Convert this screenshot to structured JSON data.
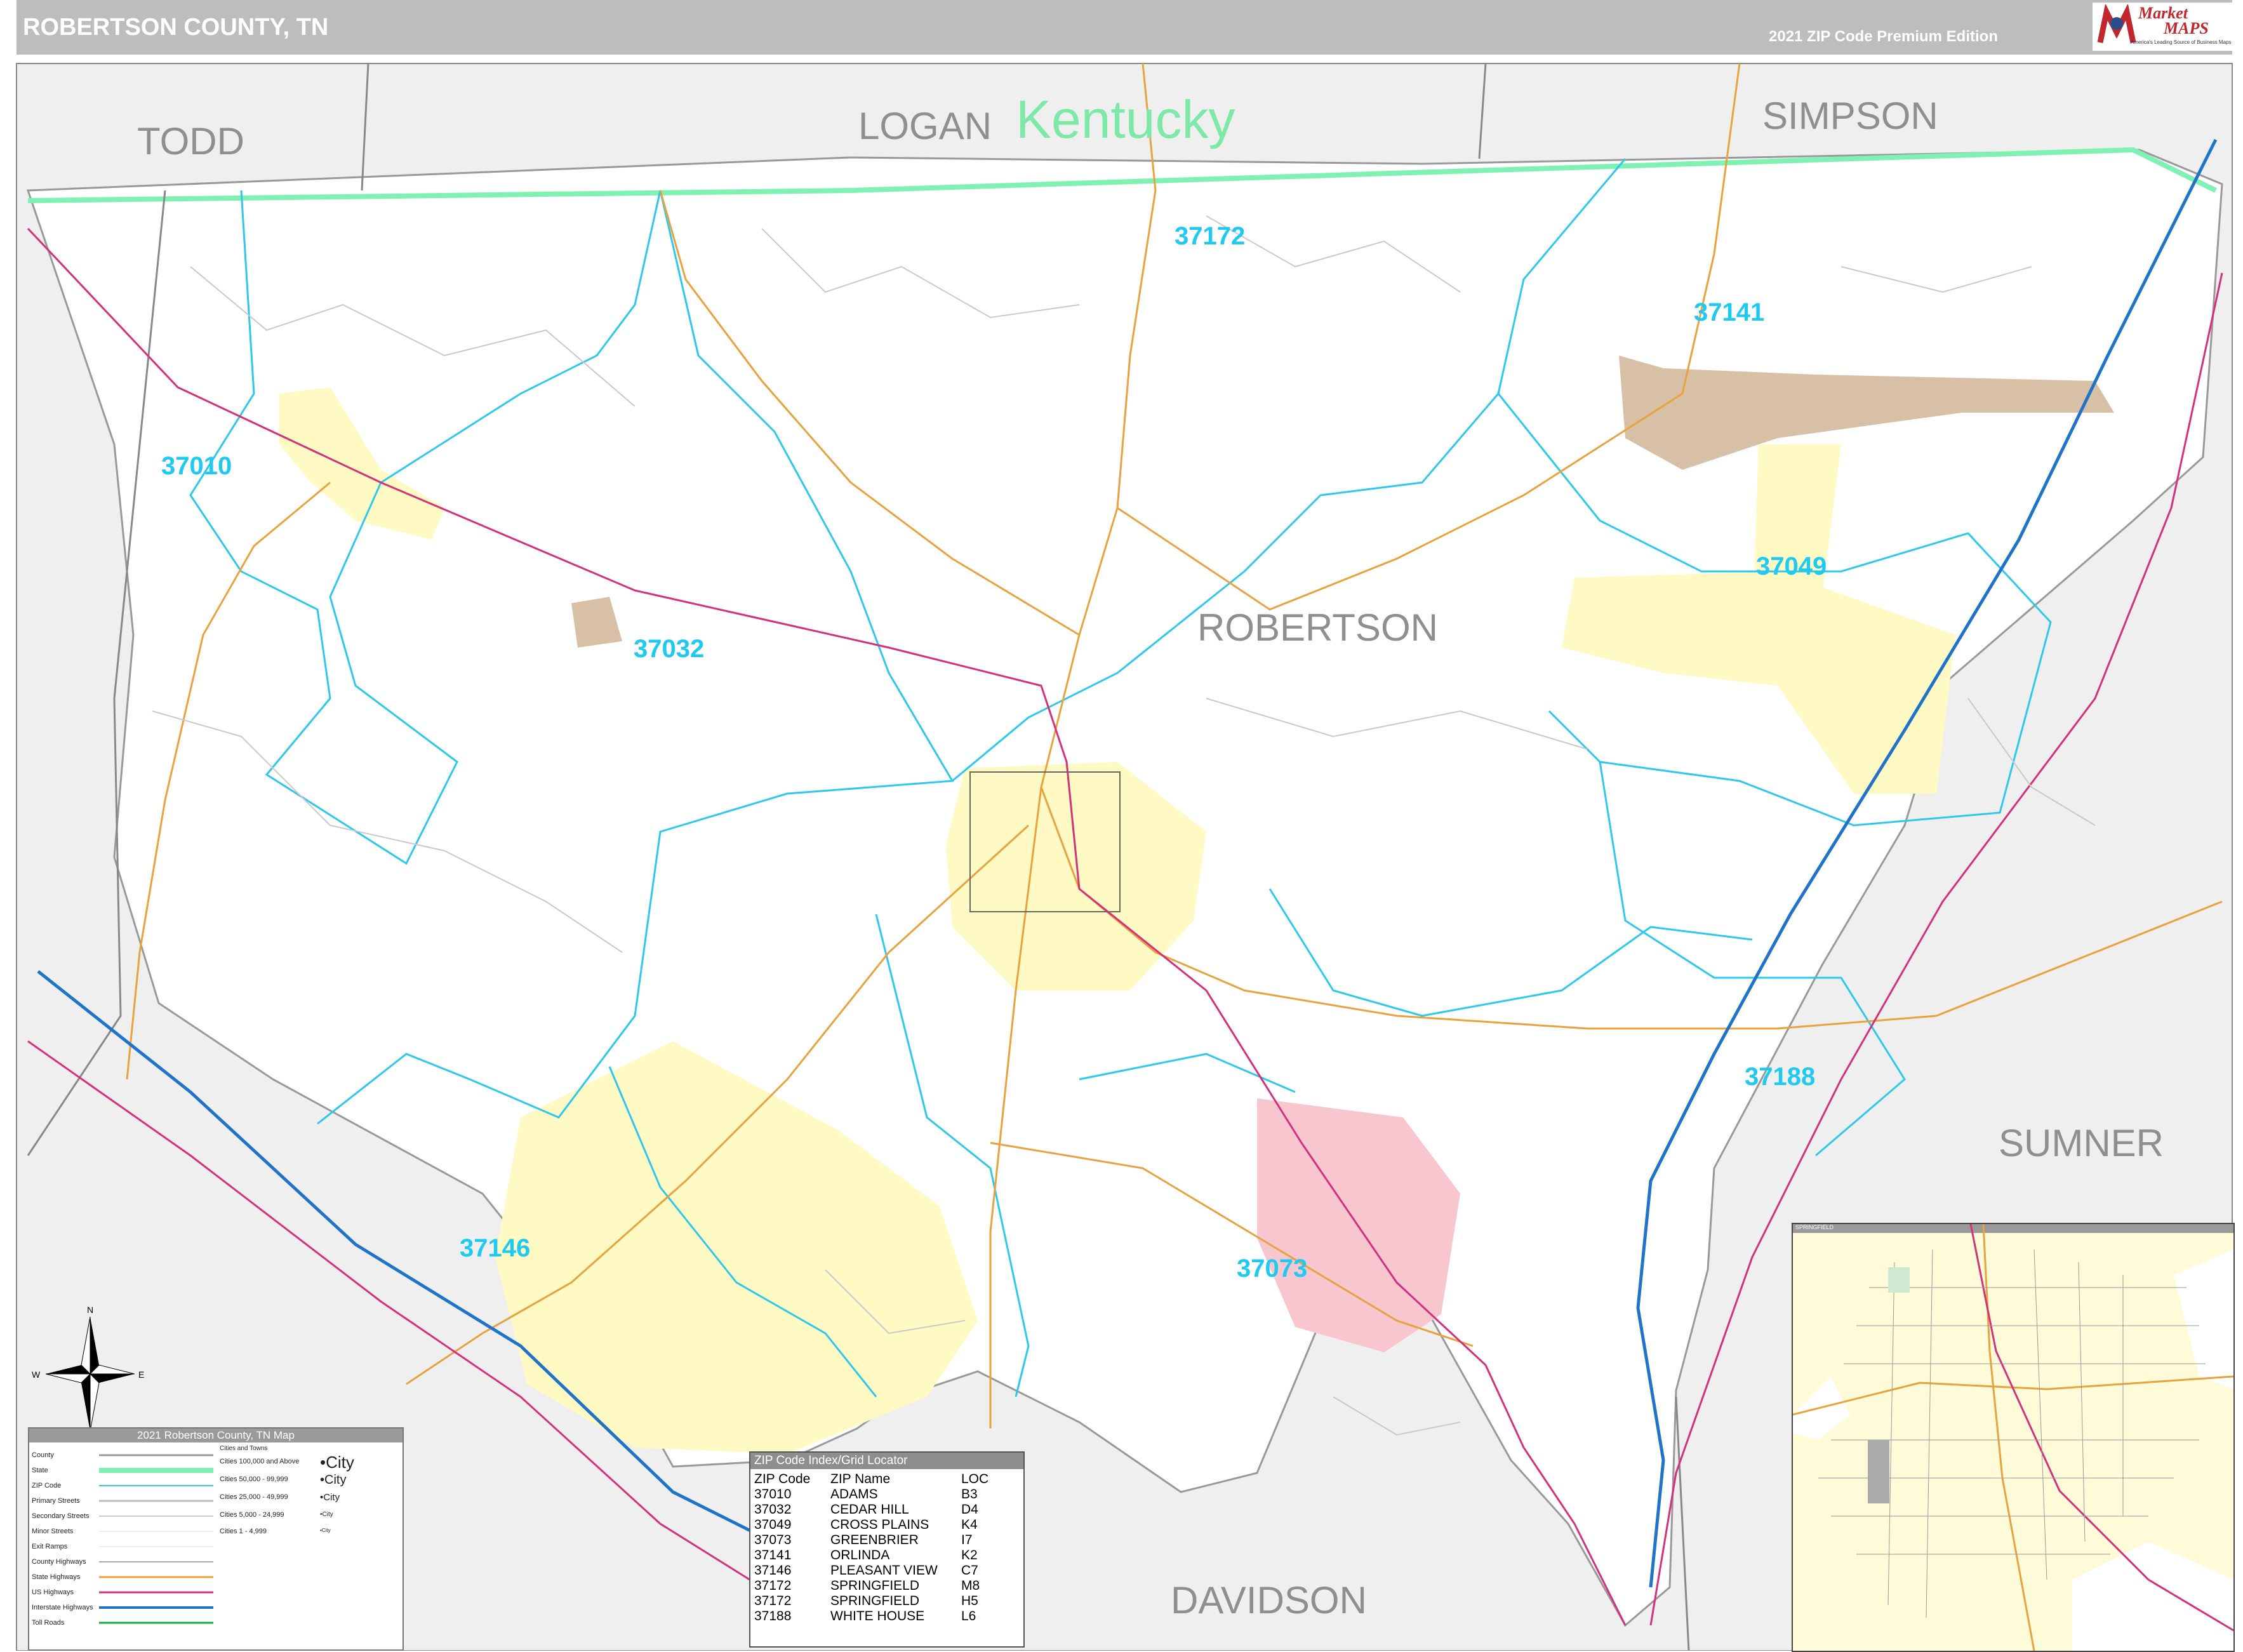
{
  "header": {
    "title": "ROBERTSON COUNTY, TN",
    "edition": "2021 ZIP Code Premium Edition",
    "logo_word1": "Market",
    "logo_word2": "MAPS",
    "logo_tagline": "America's Leading Source of Business Maps"
  },
  "map": {
    "state_label": "Kentucky",
    "counties": [
      "TODD",
      "LOGAN",
      "SIMPSON",
      "ROBERTSON",
      "SUMNER",
      "DAVIDSON"
    ],
    "zips": [
      "37172",
      "37141",
      "37010",
      "37049",
      "37032",
      "37188",
      "37146",
      "37073"
    ],
    "colors": {
      "zip_boundary": "#2ec8ee",
      "state_line": "#7ef1b3",
      "state_highway": "#e8a23e",
      "us_highway": "#d6307c",
      "interstate": "#1f73c9",
      "city_fill": "#fff9c4",
      "city_pink": "#f7c6cf",
      "city_tan": "#d8c0a6",
      "outside_fill": "#efefef"
    }
  },
  "legend": {
    "title": "2021 Robertson County, TN Map",
    "rows": [
      "County",
      "State",
      "ZIP Code",
      "Primary Streets",
      "Secondary Streets",
      "Minor Streets",
      "Exit Ramps",
      "County Highways",
      "State Highways",
      "US Highways",
      "Interstate Highways",
      "Toll Roads"
    ],
    "cities_title": "Cities and Towns",
    "cities": [
      {
        "range": "Cities 100,000 and Above",
        "sample": "•City"
      },
      {
        "range": "Cities 50,000 - 99,999",
        "sample": "•City"
      },
      {
        "range": "Cities 25,000 - 49,999",
        "sample": "•City"
      },
      {
        "range": "Cities 5,000 - 24,999",
        "sample": "•City"
      },
      {
        "range": "Cities 1 - 4,999",
        "sample": "•City"
      }
    ]
  },
  "zip_index": {
    "title": "ZIP Code Index/Grid Locator",
    "columns": [
      "ZIP Code",
      "ZIP Name",
      "LOC"
    ],
    "rows": [
      [
        "37010",
        "ADAMS",
        "B3"
      ],
      [
        "37032",
        "CEDAR HILL",
        "D4"
      ],
      [
        "37049",
        "CROSS PLAINS",
        "K4"
      ],
      [
        "37073",
        "GREENBRIER",
        "I7"
      ],
      [
        "37141",
        "ORLINDA",
        "K2"
      ],
      [
        "37146",
        "PLEASANT VIEW",
        "C7"
      ],
      [
        "37172",
        "SPRINGFIELD",
        "M8"
      ],
      [
        "37172",
        "SPRINGFIELD",
        "H5"
      ],
      [
        "37188",
        "WHITE HOUSE",
        "L6"
      ]
    ]
  },
  "inset": {
    "title": "SPRINGFIELD"
  }
}
